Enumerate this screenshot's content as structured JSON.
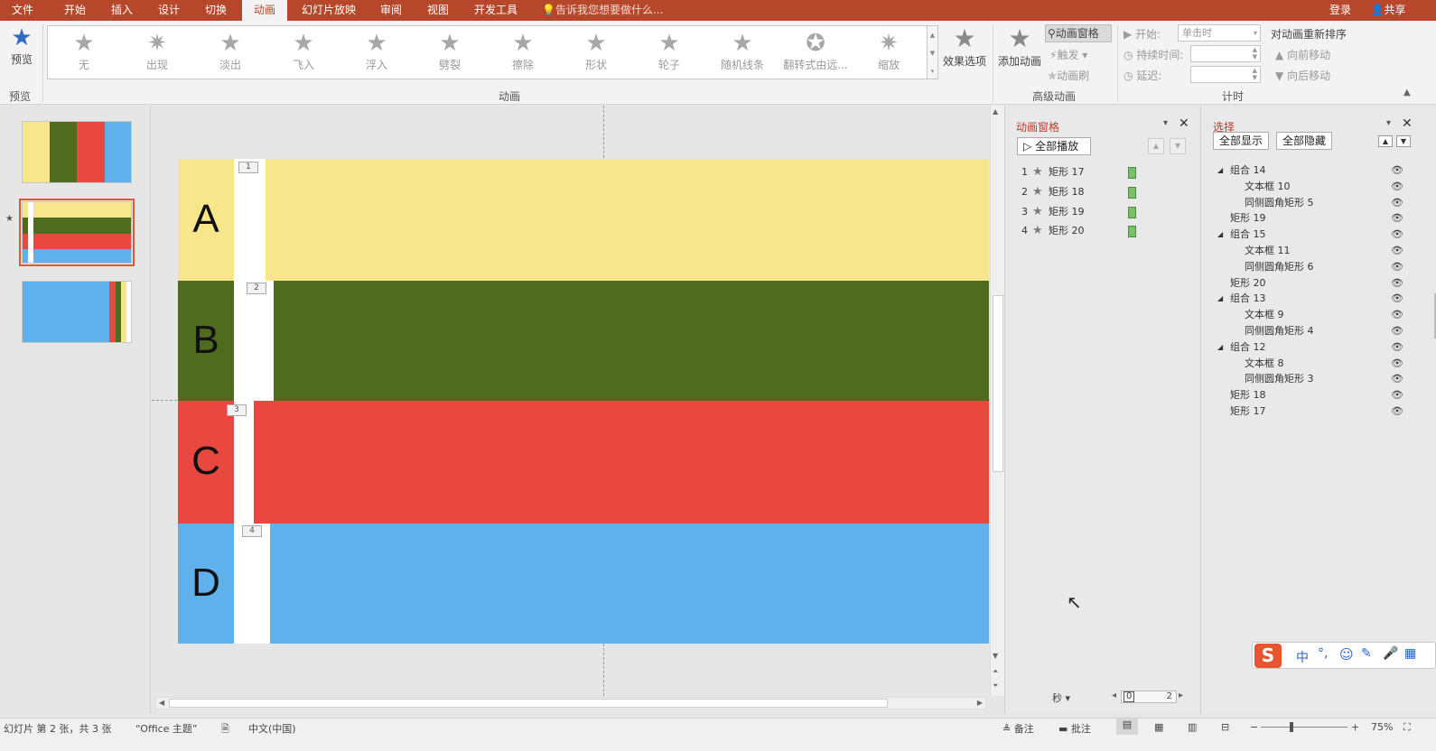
{
  "tabs": [
    "文件",
    "开始",
    "插入",
    "设计",
    "切换",
    "动画",
    "幻灯片放映",
    "审阅",
    "视图",
    "开发工具"
  ],
  "active_tab": "动画",
  "tellme": "告诉我您想要做什么...",
  "login": "登录",
  "share": "共享",
  "ribbon": {
    "preview_label": "预览",
    "preview_group": "预览",
    "anim_group": "动画",
    "gallery": [
      "无",
      "出现",
      "淡出",
      "飞入",
      "浮入",
      "劈裂",
      "擦除",
      "形状",
      "轮子",
      "随机线条",
      "翻转式由远...",
      "缩放"
    ],
    "effect_options": "效果选项",
    "add_animation": "添加动画",
    "anim_pane_btn": "动画窗格",
    "trigger": "触发",
    "anim_painter": "动画刷",
    "advanced_group": "高级动画",
    "start_label": "开始:",
    "start_value": "单击时",
    "duration_label": "持续时间:",
    "delay_label": "延迟:",
    "timing_group": "计时",
    "reorder_title": "对动画重新排序",
    "move_earlier": "向前移动",
    "move_later": "向后移动"
  },
  "slide": {
    "bands": [
      {
        "letter": "A",
        "num": "1",
        "color": "#f7e68c"
      },
      {
        "letter": "B",
        "num": "2",
        "color": "#4f6b1e"
      },
      {
        "letter": "C",
        "num": "3",
        "color": "#e94841"
      },
      {
        "letter": "D",
        "num": "4",
        "color": "#5fb1ec"
      }
    ]
  },
  "anim_pane": {
    "title": "动画窗格",
    "play_all": "全部播放",
    "items": [
      {
        "num": "1",
        "name": "矩形 17"
      },
      {
        "num": "2",
        "name": "矩形 18"
      },
      {
        "num": "3",
        "name": "矩形 19"
      },
      {
        "num": "4",
        "name": "矩形 20"
      }
    ],
    "seconds": "秒",
    "timeline_start": "0",
    "timeline_end": "2"
  },
  "sel_pane": {
    "title": "选择",
    "show_all": "全部显示",
    "hide_all": "全部隐藏",
    "items": [
      {
        "label": "组合 14",
        "level": 0,
        "group": true
      },
      {
        "label": "文本框 10",
        "level": 1
      },
      {
        "label": "同侧圆角矩形 5",
        "level": 1
      },
      {
        "label": "矩形 19",
        "level": 0
      },
      {
        "label": "组合 15",
        "level": 0,
        "group": true
      },
      {
        "label": "文本框 11",
        "level": 1
      },
      {
        "label": "同侧圆角矩形 6",
        "level": 1
      },
      {
        "label": "矩形 20",
        "level": 0
      },
      {
        "label": "组合 13",
        "level": 0,
        "group": true
      },
      {
        "label": "文本框 9",
        "level": 1
      },
      {
        "label": "同侧圆角矩形 4",
        "level": 1
      },
      {
        "label": "组合 12",
        "level": 0,
        "group": true
      },
      {
        "label": "文本框 8",
        "level": 1
      },
      {
        "label": "同侧圆角矩形 3",
        "level": 1
      },
      {
        "label": "矩形 18",
        "level": 0
      },
      {
        "label": "矩形 17",
        "level": 0
      }
    ]
  },
  "status": {
    "slide_info": "幻灯片 第 2 张，共 3 张",
    "theme": "“Office 主题”",
    "language": "中文(中国)",
    "notes": "备注",
    "comments": "批注",
    "zoom": "75%"
  },
  "ime": {
    "lang": "中"
  }
}
